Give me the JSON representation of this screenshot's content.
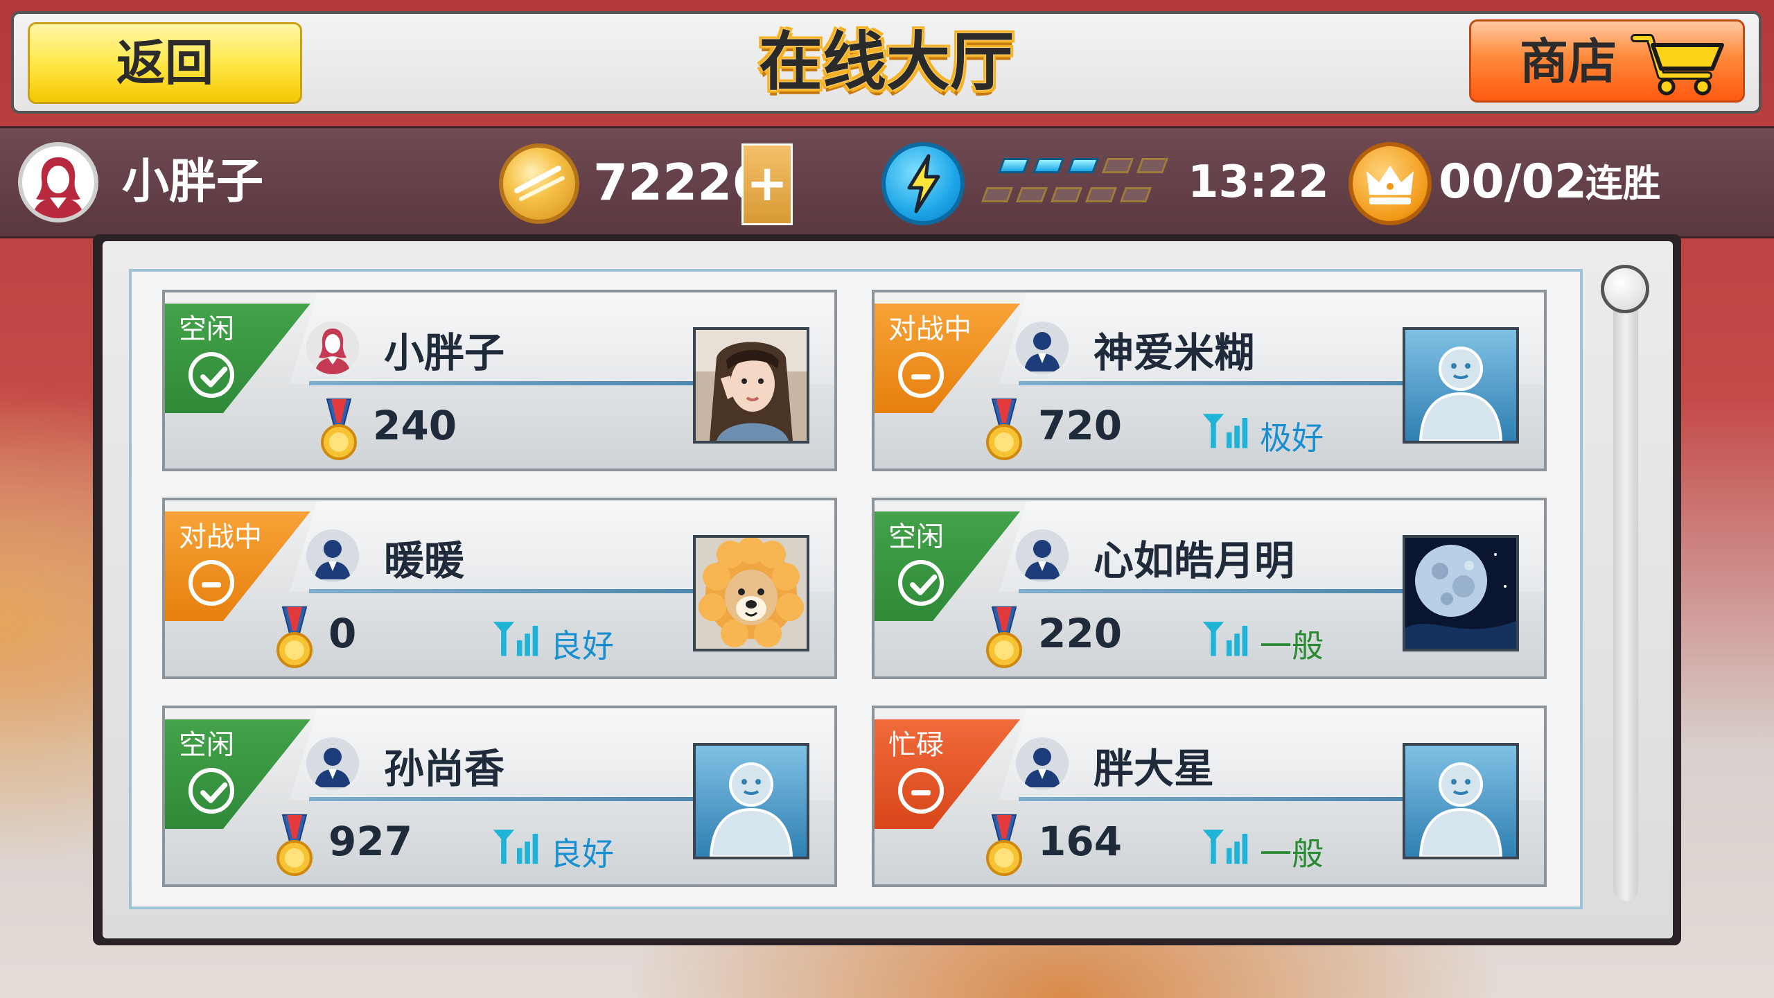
{
  "topbar": {
    "back_label": "返回",
    "title": "在线大厅",
    "shop_label": "商店"
  },
  "status": {
    "player_name": "小胖子",
    "coins": "72226",
    "plus_label": "+",
    "energy_filled": 3,
    "energy_total": 10,
    "timer": "13:22",
    "streak": "00/02",
    "streak_label": "连胜"
  },
  "colors": {
    "idle": "#2f8a38",
    "battle": "#e6800e",
    "busy": "#d8461a",
    "quality_blue": "#1a8fd0",
    "quality_green": "#2a8a32"
  },
  "players": [
    {
      "status": "空闲",
      "status_type": "idle",
      "name": "小胖子",
      "score": "240",
      "quality": "",
      "avatar": "photo-girl",
      "user_icon": "pink-female-user-icon"
    },
    {
      "status": "对战中",
      "status_type": "battle",
      "name": "神爱米糊",
      "score": "720",
      "quality": "极好",
      "quality_color": "blue",
      "avatar": "default-avatar",
      "user_icon": "blue-user-icon"
    },
    {
      "status": "对战中",
      "status_type": "battle",
      "name": "暖暖",
      "score": "0",
      "quality": "良好",
      "quality_color": "blue",
      "avatar": "photo-dog-lion",
      "user_icon": "blue-user-icon"
    },
    {
      "status": "空闲",
      "status_type": "idle",
      "name": "心如皓月明",
      "score": "220",
      "quality": "一般",
      "quality_color": "green",
      "avatar": "photo-moon",
      "user_icon": "blue-user-icon"
    },
    {
      "status": "空闲",
      "status_type": "idle",
      "name": "孙尚香",
      "score": "927",
      "quality": "良好",
      "quality_color": "blue",
      "avatar": "default-avatar",
      "user_icon": "blue-user-icon"
    },
    {
      "status": "忙碌",
      "status_type": "busy",
      "name": "胖大星",
      "score": "164",
      "quality": "一般",
      "quality_color": "green",
      "avatar": "default-avatar",
      "user_icon": "blue-user-icon"
    }
  ]
}
